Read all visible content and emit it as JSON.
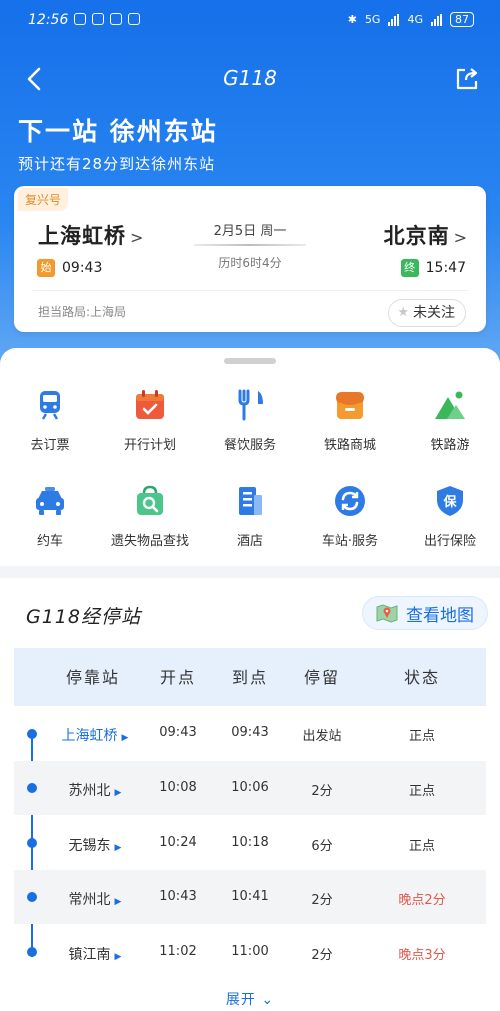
{
  "status_bar": {
    "time": "12:56",
    "network1": "5G",
    "network2": "4G",
    "battery": "87"
  },
  "nav": {
    "title": "G118"
  },
  "next_station": {
    "title": "下一站 徐州东站",
    "subtitle": "预计还有28分到达徐州东站"
  },
  "train": {
    "type_tag": "复兴号",
    "from": "上海虹桥",
    "to": "北京南",
    "date": "2月5日 周一",
    "duration": "历时6时4分",
    "dep_badge": "始",
    "dep_time": "09:43",
    "arr_badge": "终",
    "arr_time": "15:47",
    "bureau": "担当路局:上海局",
    "follow_label": "未关注"
  },
  "services": [
    {
      "label": "去订票",
      "icon": "train-icon"
    },
    {
      "label": "开行计划",
      "icon": "calendar-icon"
    },
    {
      "label": "餐饮服务",
      "icon": "cutlery-icon"
    },
    {
      "label": "铁路商城",
      "icon": "store-icon"
    },
    {
      "label": "铁路游",
      "icon": "mountain-icon"
    },
    {
      "label": "约车",
      "icon": "car-icon"
    },
    {
      "label": "遗失物品查找",
      "icon": "lost-found-icon"
    },
    {
      "label": "酒店",
      "icon": "hotel-icon"
    },
    {
      "label": "车站·服务",
      "icon": "refresh-icon"
    },
    {
      "label": "出行保险",
      "icon": "insurance-icon"
    }
  ],
  "stops": {
    "title": "G118经停站",
    "map_button": "查看地图",
    "headers": [
      "停靠站",
      "开点",
      "到点",
      "停留",
      "状态"
    ],
    "rows": [
      {
        "station": "上海虹桥",
        "depart": "09:43",
        "arrive": "09:43",
        "stay": "出发站",
        "status": "正点"
      },
      {
        "station": "苏州北",
        "depart": "10:08",
        "arrive": "10:06",
        "stay": "2分",
        "status": "正点"
      },
      {
        "station": "无锡东",
        "depart": "10:24",
        "arrive": "10:18",
        "stay": "6分",
        "status": "正点"
      },
      {
        "station": "常州北",
        "depart": "10:43",
        "arrive": "10:41",
        "stay": "2分",
        "status": "晚点2分"
      },
      {
        "station": "镇江南",
        "depart": "11:02",
        "arrive": "11:00",
        "stay": "2分",
        "status": "晚点3分"
      }
    ],
    "expand_label": "展开"
  },
  "colors": {
    "primary": "#1a6fe0",
    "late": "#e05a4a",
    "dep_badge": "#f29a2e",
    "arr_badge": "#3cb85c"
  }
}
